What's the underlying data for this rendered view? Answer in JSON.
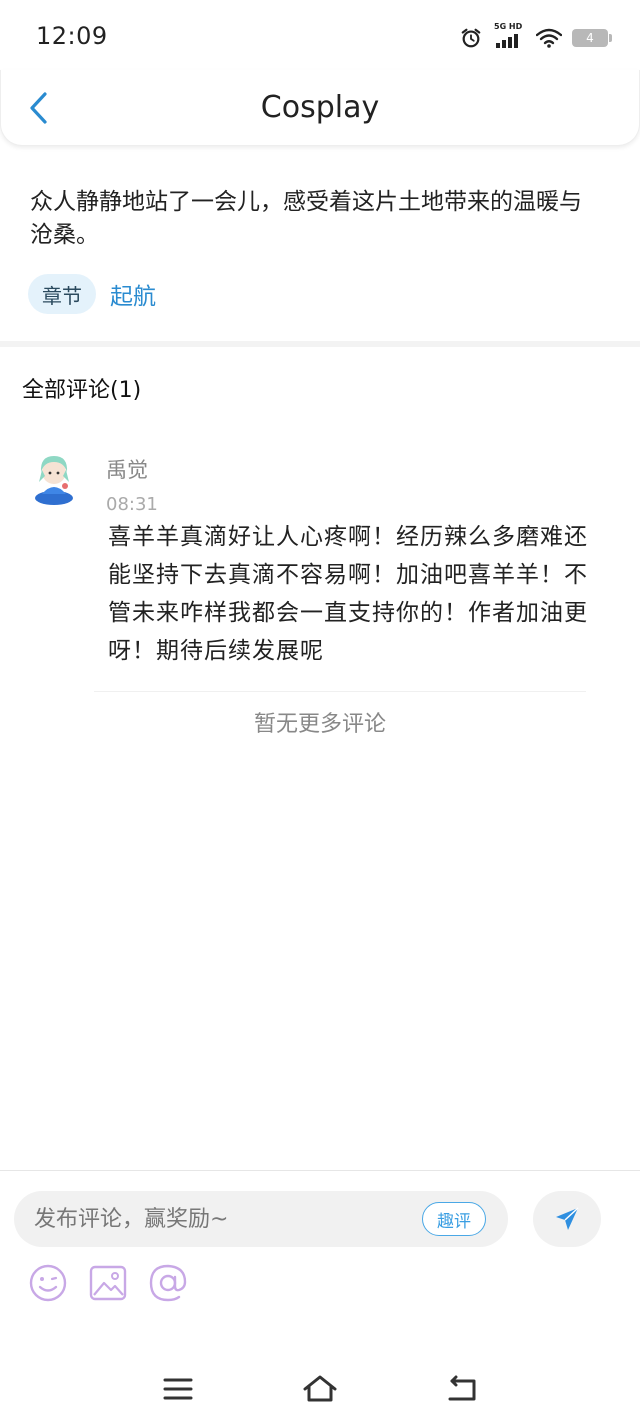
{
  "status": {
    "time": "12:09",
    "network_label": "5G HD",
    "battery_level": "4",
    "icons": [
      "alarm-icon",
      "signal-icon",
      "wifi-icon",
      "battery-icon"
    ]
  },
  "header": {
    "back_icon": "chevron-left-icon",
    "title": "Cosplay"
  },
  "post": {
    "summary": "众人静静地站了一会儿，感受着这片土地带来的温暖与沧桑。",
    "chapter_chip": "章节",
    "chapter_name": "起航"
  },
  "comments": {
    "header": "全部评论(1)",
    "items": [
      {
        "user": "禹觉",
        "time": "08:31",
        "text": "喜羊羊真滴好让人心疼啊！经历辣么多磨难还能坚持下去真滴不容易啊！加油吧喜羊羊！不管未来咋样我都会一直支持你的！作者加油更呀！期待后续发展呢"
      }
    ],
    "end_text": "暂无更多评论"
  },
  "composer": {
    "placeholder": "发布评论，赢奖励~",
    "fun_review_label": "趣评",
    "send_icon": "send-icon",
    "tools": [
      "emoji-icon",
      "image-icon",
      "mention-icon"
    ]
  },
  "system_nav": {
    "icons": [
      "menu-icon",
      "home-icon",
      "back-icon"
    ]
  },
  "colors": {
    "accent": "#2a8bd0",
    "chip_bg": "#e4f2fb",
    "tool_purple": "#c8a8e6"
  }
}
